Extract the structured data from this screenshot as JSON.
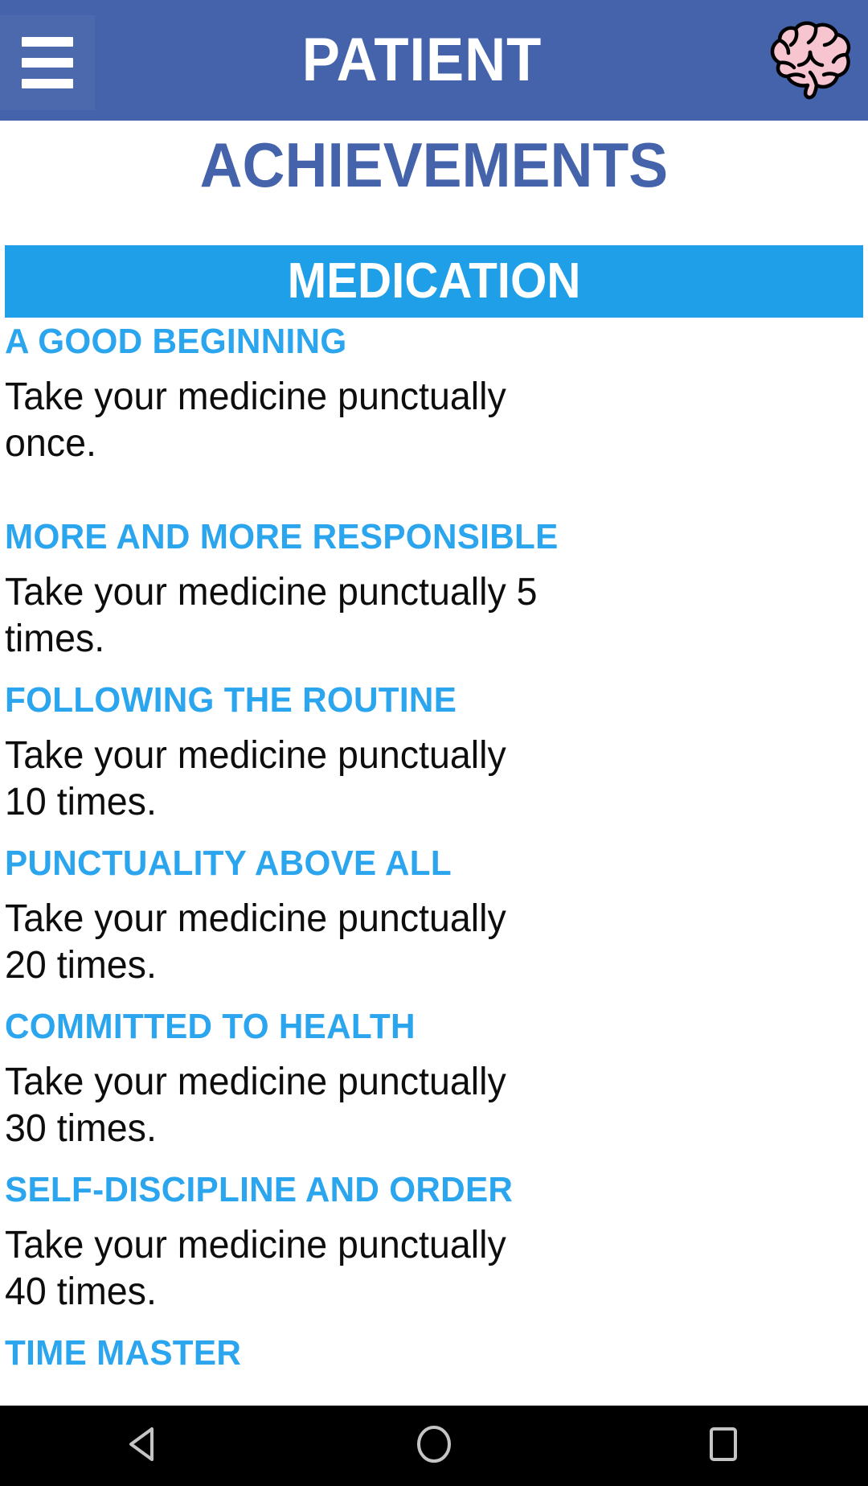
{
  "app_bar": {
    "title": "PATIENT",
    "menu_icon": "hamburger-menu-icon",
    "logo_icon": "brain-icon",
    "background_color": "#4463ab"
  },
  "page": {
    "title": "ACHIEVEMENTS",
    "title_color": "#4463ab",
    "background_color": "#ffffff"
  },
  "category_banner": {
    "label": "MEDICATION",
    "background_color": "#1f9fe8",
    "text_color": "#ffffff"
  },
  "achievements": {
    "title_color": "#2ba5ee",
    "description_color": "#0d0d0d",
    "items": [
      {
        "title": "A GOOD BEGINNING",
        "description": "Take your medicine punctually once."
      },
      {
        "title": "MORE AND MORE RESPONSIBLE",
        "description": "Take your medicine punctually 5 times."
      },
      {
        "title": "FOLLOWING THE ROUTINE",
        "description": "Take your medicine punctually 10 times."
      },
      {
        "title": "PUNCTUALITY ABOVE ALL",
        "description": "Take your medicine punctually 20 times."
      },
      {
        "title": "COMMITTED TO HEALTH",
        "description": "Take your medicine punctually 30 times."
      },
      {
        "title": "SELF-DISCIPLINE AND ORDER",
        "description": "Take your medicine punctually 40 times."
      },
      {
        "title": "TIME MASTER",
        "description": ""
      }
    ]
  },
  "system_nav": {
    "background_color": "#000000",
    "icon_color": "#c4c4c4",
    "back_icon": "back-triangle-icon",
    "home_icon": "home-circle-icon",
    "recents_icon": "recents-square-icon"
  }
}
